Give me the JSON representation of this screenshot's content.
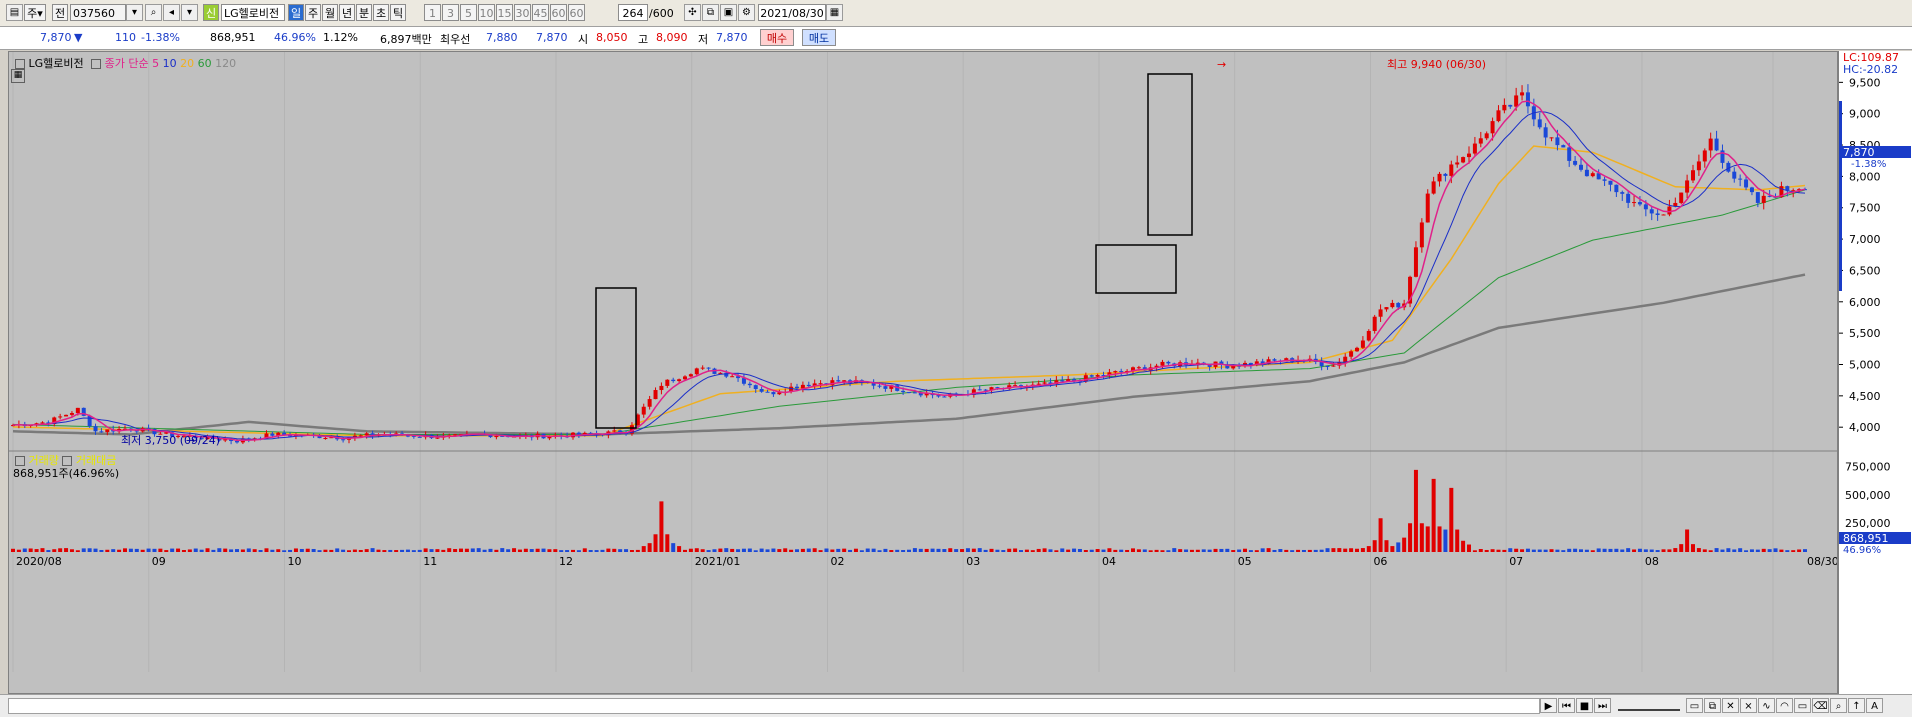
{
  "toolbar": {
    "period_unit": "주",
    "market": "전",
    "code": "037560",
    "new_badge": "신",
    "stock_name": "LG헬로비전",
    "period_tabs": [
      "일",
      "주",
      "월",
      "년",
      "분",
      "초",
      "틱"
    ],
    "intervals": [
      "1",
      "3",
      "5",
      "10",
      "15",
      "30",
      "45",
      "60",
      "60"
    ],
    "count": "264",
    "count_max": "/600",
    "date": "2021/08/30"
  },
  "quote": {
    "price": "7,870",
    "change": "110",
    "change_pct": "-1.38%",
    "volume": "868,951",
    "vol_ratio": "46.96%",
    "turnover": "1.12%",
    "amount": "6,897백만",
    "bid_label": "최우선",
    "ask_price": "7,880",
    "bid_price": "7,870",
    "open_label": "시",
    "open": "8,050",
    "high_label": "고",
    "high": "8,090",
    "low_label": "저",
    "low": "7,870",
    "buy_label": "매수",
    "sell_label": "매도"
  },
  "legend": {
    "name": "LG헬로비전",
    "ma_label": "종가 단순",
    "ma_periods": [
      "5",
      "10",
      "20",
      "60",
      "120"
    ],
    "colors": {
      "ma5": "#e0218a",
      "ma10": "#1a2ec8",
      "ma20": "#f0b020",
      "ma60": "#2a9a3a",
      "ma120": "#808080"
    }
  },
  "annotations": {
    "high_note": "최고 9,940 (06/30)",
    "low_note": "최저 3,750 (09/24)",
    "lc": "LC:109.87",
    "hc": "HC:-20.82",
    "current_price_tag": "7,870",
    "current_change_tag": "-1.38%"
  },
  "volume_panel": {
    "title1": "거래량",
    "title2": "거래대금",
    "value_line": "868,951주(46.96%)",
    "current_tag": "868,951",
    "current_pct": "46.96%"
  },
  "chart_data": {
    "type": "candlestick",
    "y_ticks": [
      "9,500",
      "9,000",
      "8,500",
      "8,000",
      "7,500",
      "7,000",
      "6,500",
      "6,000",
      "5,500",
      "5,000",
      "4,500",
      "4,000"
    ],
    "ylim": [
      3700,
      10000
    ],
    "volume_ticks": [
      "750,000",
      "500,000",
      "250,000"
    ],
    "x_ticks": [
      "2020/08",
      "09",
      "10",
      "11",
      "12",
      "2021/01",
      "02",
      "03",
      "04",
      "05",
      "06",
      "07",
      "08",
      "08/30"
    ],
    "price_path": [
      [
        0,
        4050
      ],
      [
        6,
        4100
      ],
      [
        11,
        4300
      ],
      [
        14,
        3950
      ],
      [
        20,
        4000
      ],
      [
        26,
        3900
      ],
      [
        32,
        3850
      ],
      [
        38,
        3800
      ],
      [
        44,
        3900
      ],
      [
        50,
        3880
      ],
      [
        56,
        3850
      ],
      [
        62,
        3900
      ],
      [
        68,
        3880
      ],
      [
        74,
        3860
      ],
      [
        80,
        3900
      ],
      [
        86,
        3870
      ],
      [
        92,
        3880
      ],
      [
        98,
        3900
      ],
      [
        104,
        3950
      ],
      [
        110,
        4700
      ],
      [
        116,
        4950
      ],
      [
        122,
        4850
      ],
      [
        128,
        4550
      ],
      [
        134,
        4700
      ],
      [
        140,
        4750
      ],
      [
        146,
        4700
      ],
      [
        152,
        4600
      ],
      [
        158,
        4500
      ],
      [
        164,
        4600
      ],
      [
        170,
        4650
      ],
      [
        176,
        4700
      ],
      [
        182,
        4800
      ],
      [
        188,
        4900
      ],
      [
        194,
        5000
      ],
      [
        200,
        5050
      ],
      [
        206,
        5000
      ],
      [
        212,
        5050
      ],
      [
        218,
        5100
      ],
      [
        224,
        5000
      ],
      [
        228,
        5300
      ],
      [
        232,
        5900
      ],
      [
        236,
        6000
      ],
      [
        240,
        7800
      ],
      [
        244,
        8200
      ],
      [
        248,
        8500
      ],
      [
        252,
        9000
      ],
      [
        256,
        9300
      ],
      [
        260,
        8700
      ],
      [
        264,
        8300
      ],
      [
        268,
        8000
      ],
      [
        272,
        7800
      ],
      [
        276,
        7500
      ],
      [
        280,
        7400
      ],
      [
        284,
        7900
      ],
      [
        288,
        8600
      ],
      [
        292,
        8000
      ],
      [
        296,
        7600
      ],
      [
        300,
        7800
      ],
      [
        304,
        7870
      ]
    ],
    "ma_paths": {
      "ma20": [
        [
          0,
          4020
        ],
        [
          60,
          3880
        ],
        [
          100,
          3880
        ],
        [
          120,
          4550
        ],
        [
          150,
          4750
        ],
        [
          180,
          4850
        ],
        [
          200,
          4950
        ],
        [
          220,
          5050
        ],
        [
          234,
          5400
        ],
        [
          244,
          6700
        ],
        [
          252,
          7900
        ],
        [
          258,
          8500
        ],
        [
          268,
          8400
        ],
        [
          282,
          7850
        ],
        [
          296,
          7800
        ],
        [
          304,
          7870
        ]
      ],
      "ma60": [
        [
          0,
          4060
        ],
        [
          60,
          3900
        ],
        [
          100,
          3900
        ],
        [
          130,
          4350
        ],
        [
          160,
          4650
        ],
        [
          190,
          4850
        ],
        [
          220,
          4950
        ],
        [
          236,
          5200
        ],
        [
          252,
          6400
        ],
        [
          268,
          7000
        ],
        [
          290,
          7400
        ],
        [
          304,
          7800
        ]
      ],
      "ma120": [
        [
          0,
          3950
        ],
        [
          20,
          3900
        ],
        [
          40,
          4100
        ],
        [
          60,
          3950
        ],
        [
          100,
          3900
        ],
        [
          130,
          4000
        ],
        [
          160,
          4150
        ],
        [
          190,
          4500
        ],
        [
          220,
          4750
        ],
        [
          236,
          5050
        ],
        [
          252,
          5600
        ],
        [
          280,
          6000
        ],
        [
          304,
          6450
        ]
      ]
    },
    "volume_spikes": [
      {
        "x": 110,
        "value": 450000
      },
      {
        "x": 232,
        "value": 300000
      },
      {
        "x": 238,
        "value": 730000
      },
      {
        "x": 241,
        "value": 650000
      },
      {
        "x": 244,
        "value": 570000
      },
      {
        "x": 284,
        "value": 200000
      }
    ]
  }
}
